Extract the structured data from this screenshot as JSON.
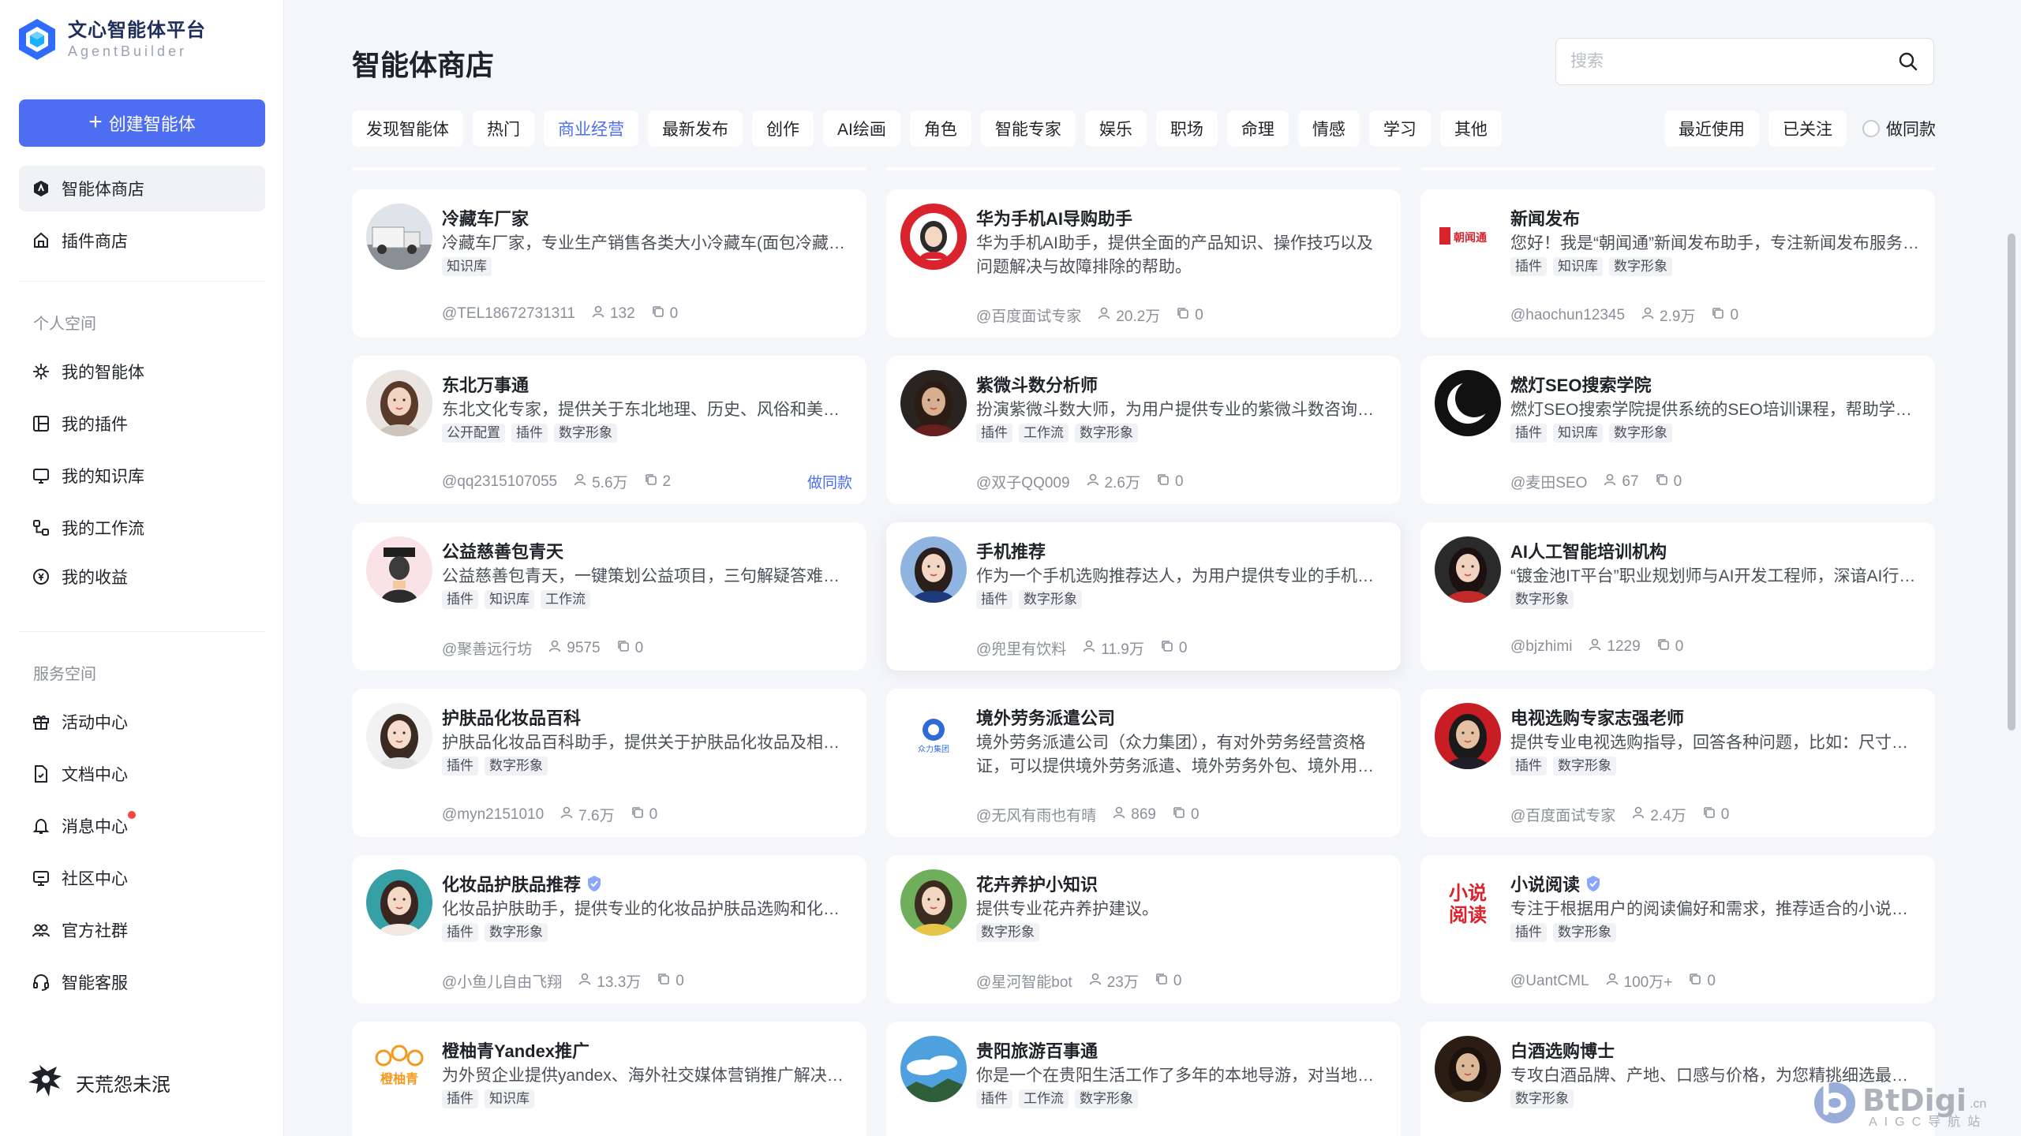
{
  "brand": {
    "title": "文心智能体平台",
    "subtitle": "AgentBuilder",
    "accent": "#4e6ef2"
  },
  "sidebar": {
    "create_label": "创建智能体",
    "store_items": [
      {
        "label": "智能体商店",
        "icon": "store-icon",
        "active": true
      },
      {
        "label": "插件商店",
        "icon": "plugin-store-icon",
        "active": false
      }
    ],
    "personal_title": "个人空间",
    "personal_items": [
      {
        "label": "我的智能体",
        "icon": "sparkle-icon"
      },
      {
        "label": "我的插件",
        "icon": "plugin-icon"
      },
      {
        "label": "我的知识库",
        "icon": "knowledge-icon"
      },
      {
        "label": "我的工作流",
        "icon": "workflow-icon"
      },
      {
        "label": "我的收益",
        "icon": "coin-icon"
      }
    ],
    "service_title": "服务空间",
    "service_items": [
      {
        "label": "活动中心",
        "icon": "gift-icon"
      },
      {
        "label": "文档中心",
        "icon": "document-icon"
      },
      {
        "label": "消息中心",
        "icon": "bell-icon",
        "has_dot": true
      },
      {
        "label": "社区中心",
        "icon": "community-icon"
      },
      {
        "label": "官方社群",
        "icon": "group-icon"
      },
      {
        "label": "智能客服",
        "icon": "headset-icon"
      }
    ],
    "user_name": "天荒怨未泯"
  },
  "main": {
    "title": "智能体商店",
    "search_placeholder": "搜索",
    "tabs": [
      "发现智能体",
      "热门",
      "商业经营",
      "最新发布",
      "创作",
      "AI绘画",
      "角色",
      "智能专家",
      "娱乐",
      "职场",
      "命理",
      "情感",
      "学习",
      "其他"
    ],
    "active_tab": "商业经营",
    "right_filters": [
      "最近使用",
      "已关注"
    ],
    "toggle_label": "做同款"
  },
  "cards": [
    {
      "name": "冷藏车厂家",
      "desc": "冷藏车厂家，专业生产销售各类大小冷藏车(面包冷藏车、小型冷藏车、中型冷藏车)",
      "tags": [
        "知识库"
      ],
      "author": "@TEL18672731311",
      "users": "132",
      "copies": "0",
      "avatar": "truck",
      "lines": 1
    },
    {
      "name": "华为手机AI导购助手",
      "desc": "华为手机AI助手，提供全面的产品知识、操作技巧以及问题解决与故障排除的帮助。",
      "tags": [],
      "author": "@百度面试专家",
      "users": "20.2万",
      "copies": "0",
      "avatar": "red-girl",
      "lines": 2
    },
    {
      "name": "新闻发布",
      "desc": "您好！我是“朝闻通”新闻发布助手，专注新闻发布服务，为您提供专业支持",
      "tags": [
        "插件",
        "知识库",
        "数字形象"
      ],
      "author": "@haochun12345",
      "users": "2.9万",
      "copies": "0",
      "avatar": "news-logo",
      "lines": 1
    },
    {
      "name": "东北万事通",
      "desc": "东北文化专家，提供关于东北地理、历史、风俗和美食的全面介绍",
      "tags": [
        "公开配置",
        "插件",
        "数字形象"
      ],
      "author": "@qq2315107055",
      "users": "5.6万",
      "copies": "2",
      "avatar": "girl-brown",
      "lines": 1,
      "action": "做同款"
    },
    {
      "name": "紫微斗数分析师",
      "desc": "扮演紫微斗数大师，为用户提供专业的紫微斗数咨询服务",
      "tags": [
        "插件",
        "工作流",
        "数字形象"
      ],
      "author": "@双子QQ009",
      "users": "2.6万",
      "copies": "0",
      "avatar": "master",
      "lines": 1
    },
    {
      "name": "燃灯SEO搜索学院",
      "desc": "燃灯SEO搜索学院提供系统的SEO培训课程，帮助学员掌握搜索优化技能",
      "tags": [
        "插件",
        "知识库",
        "数字形象"
      ],
      "author": "@麦田SEO",
      "users": "67",
      "copies": "0",
      "avatar": "moon-logo",
      "lines": 1
    },
    {
      "name": "公益慈善包青天",
      "desc": "公益慈善包青天，一键策划公益项目，三句解疑答难，助力慈善事业",
      "tags": [
        "插件",
        "知识库",
        "工作流"
      ],
      "author": "@聚善远行坊",
      "users": "9575",
      "copies": "0",
      "avatar": "judge",
      "lines": 1
    },
    {
      "name": "手机推荐",
      "desc": "作为一个手机选购推荐达人，为用户提供专业的手机选购建议与推荐",
      "tags": [
        "插件",
        "数字形象"
      ],
      "author": "@兜里有饮料",
      "users": "11.9万",
      "copies": "0",
      "avatar": "phone-girl",
      "lines": 1,
      "hover": true
    },
    {
      "name": "AI人工智能培训机构",
      "desc": "“镀金池IT平台”职业规划师与AI开发工程师，深谙AI行业发展趋势",
      "tags": [
        "数字形象"
      ],
      "author": "@bjzhimi",
      "users": "1229",
      "copies": "0",
      "avatar": "girl-dark",
      "lines": 1
    },
    {
      "name": "护肤品化妆品百科",
      "desc": "护肤品化妆品百科助手，提供关于护肤品化妆品及相关知识的全面解答",
      "tags": [
        "插件",
        "数字形象"
      ],
      "author": "@myn2151010",
      "users": "7.6万",
      "copies": "0",
      "avatar": "girl-white",
      "lines": 1
    },
    {
      "name": "境外劳务派遣公司",
      "desc": "境外劳务派遣公司（众力集团），有对外劳务经营资格证，可以提供境外劳务派遣、境外劳务外包、境外用工服务",
      "tags": [],
      "author": "@无风有雨也有晴",
      "users": "869",
      "copies": "0",
      "avatar": "company-logo",
      "lines": 2
    },
    {
      "name": "电视选购专家志强老师",
      "desc": "提供专业电视选购指导，回答各种问题，比如：尺寸、分辨率、品牌选择等",
      "tags": [
        "插件",
        "数字形象"
      ],
      "author": "@百度面试专家",
      "users": "2.4万",
      "copies": "0",
      "avatar": "tv-man",
      "lines": 1
    },
    {
      "name": "化妆品护肤品推荐",
      "desc": "化妆品护肤助手，提供专业的化妆品护肤品选购和化妆技巧建议",
      "tags": [
        "插件",
        "数字形象"
      ],
      "author": "@小鱼儿自由飞翔",
      "users": "13.3万",
      "copies": "0",
      "avatar": "girl-teal",
      "lines": 1,
      "verified": true
    },
    {
      "name": "花卉养护小知识",
      "desc": "提供专业花卉养护建议。",
      "tags": [
        "数字形象"
      ],
      "author": "@星河智能bot",
      "users": "23万",
      "copies": "0",
      "avatar": "flower-girl",
      "lines": 1
    },
    {
      "name": "小说阅读",
      "desc": "专注于根据用户的阅读偏好和需求，推荐适合的小说作品",
      "tags": [
        "插件",
        "数字形象"
      ],
      "author": "@UantCML",
      "users": "100万+",
      "copies": "0",
      "avatar": "novel-logo",
      "lines": 1,
      "verified": true
    },
    {
      "name": "橙柚青Yandex推广",
      "desc": "为外贸企业提供yandex、海外社交媒体营销推广解决方案",
      "tags": [
        "插件",
        "知识库"
      ],
      "author": "",
      "users": "",
      "copies": "",
      "avatar": "orange-logo",
      "lines": 1
    },
    {
      "name": "贵阳旅游百事通",
      "desc": "你是一个在贵阳生活工作了多年的本地导游，对当地景点了如指掌",
      "tags": [
        "插件",
        "工作流",
        "数字形象"
      ],
      "author": "",
      "users": "",
      "copies": "",
      "avatar": "sky",
      "lines": 1
    },
    {
      "name": "白酒选购博士",
      "desc": "专攻白酒品牌、产地、口感与价格，为您精挑细选最合适的白酒",
      "tags": [
        "数字形象"
      ],
      "author": "",
      "users": "",
      "copies": "",
      "avatar": "wine-man",
      "lines": 1
    }
  ],
  "watermark": {
    "text": "BtDigi",
    "sub": "AIGC导航站",
    "suffix": ".cn"
  }
}
